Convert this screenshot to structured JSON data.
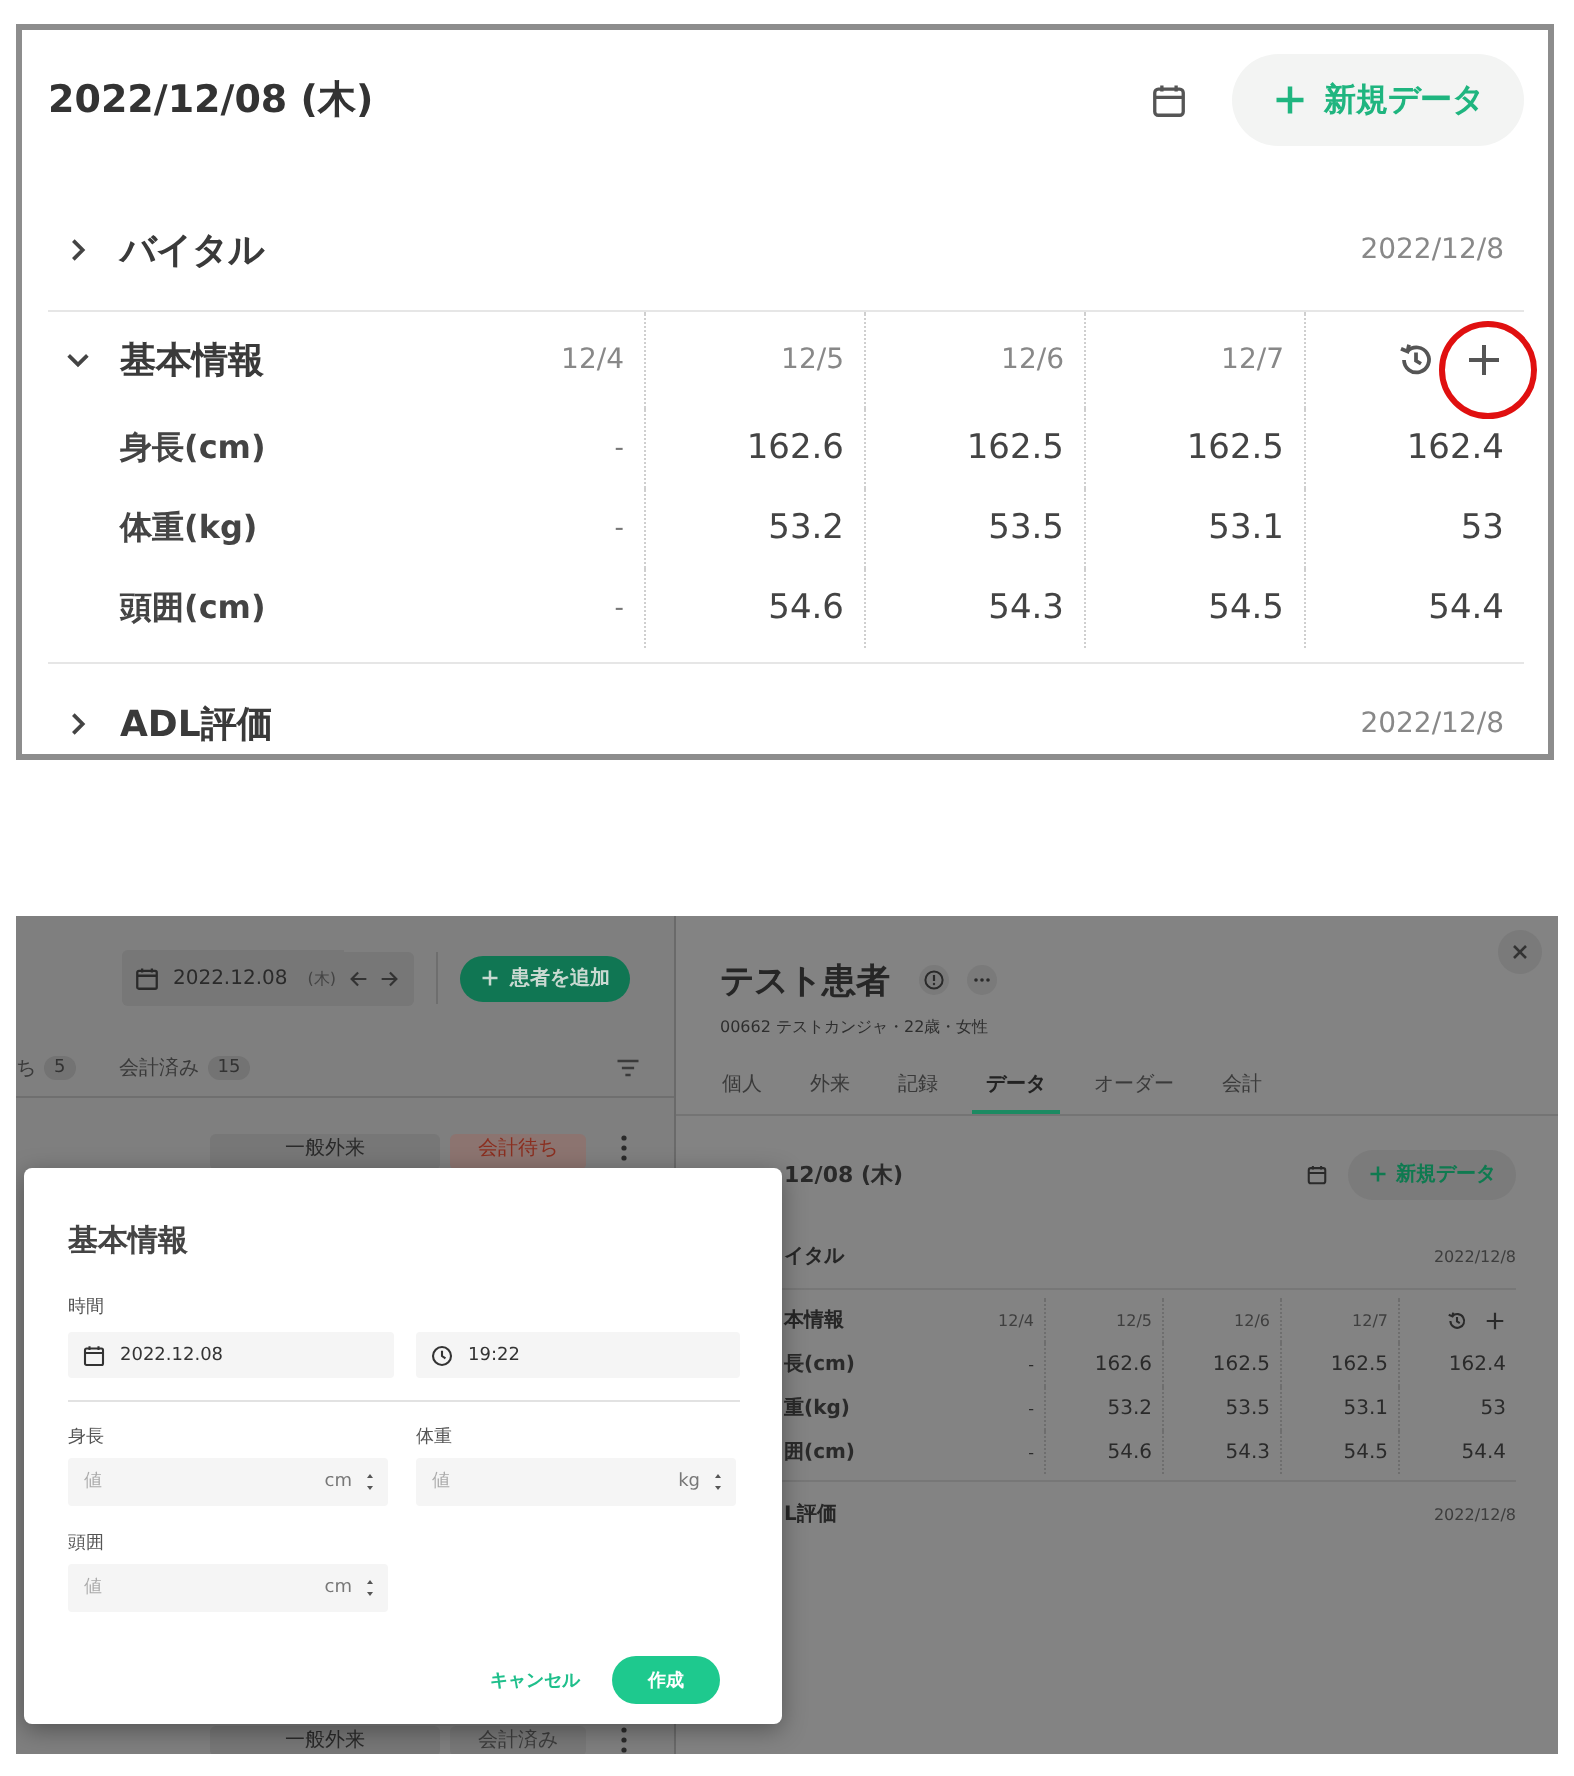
{
  "zoomed_panel": {
    "date": "2022/12/08 (木)",
    "new_button": "新規データ",
    "sections": [
      {
        "kind": "section",
        "title": "バイタル",
        "expanded": false,
        "date": "2022/12/8"
      },
      {
        "kind": "table",
        "title": "基本情報",
        "expanded": true,
        "columns": [
          "12/4",
          "12/5",
          "12/6",
          "12/7"
        ],
        "rows": [
          {
            "label": "身長(cm)",
            "values": [
              "-",
              "162.6",
              "162.5",
              "162.5",
              "162.4"
            ]
          },
          {
            "label": "体重(kg)",
            "values": [
              "-",
              "53.2",
              "53.5",
              "53.1",
              "53"
            ]
          },
          {
            "label": "頭囲(cm)",
            "values": [
              "-",
              "54.6",
              "54.3",
              "54.5",
              "54.4"
            ]
          }
        ]
      },
      {
        "kind": "section",
        "title": "ADL評価",
        "expanded": false,
        "date": "2022/12/8"
      }
    ]
  },
  "screen": {
    "left_pane": {
      "date": "2022.12.08",
      "weekday": "(木)",
      "add_button": "患者を追加",
      "tabs": [
        {
          "label": "ち",
          "count": "5"
        },
        {
          "label": "会計済み",
          "count": "15"
        }
      ],
      "rows": [
        {
          "tags": [
            {
              "label": "一般外来",
              "kind": "visit"
            },
            {
              "label": "会計待ち",
              "kind": "pending"
            }
          ]
        },
        {
          "tags": [
            {
              "label": "一般外来",
              "kind": "visit"
            },
            {
              "label": "会計済み",
              "kind": "done"
            }
          ]
        }
      ]
    },
    "right_pane": {
      "patient_name": "テスト患者",
      "patient_info": "00662 テストカンジャ・22歳・女性",
      "tabs": [
        {
          "label": "個人",
          "selected": false
        },
        {
          "label": "外来",
          "selected": false
        },
        {
          "label": "記録",
          "selected": false
        },
        {
          "label": "データ",
          "selected": true
        },
        {
          "label": "オーダー",
          "selected": false
        },
        {
          "label": "会計",
          "selected": false
        }
      ],
      "data": {
        "date": "12/08 (木)",
        "new_button": "新規データ",
        "sections": [
          {
            "kind": "section",
            "title": "イタル",
            "date": "2022/12/8"
          },
          {
            "kind": "table",
            "title": "本情報",
            "columns": [
              "12/4",
              "12/5",
              "12/6",
              "12/7"
            ],
            "rows": [
              {
                "label": "長(cm)",
                "values": [
                  "-",
                  "162.6",
                  "162.5",
                  "162.5",
                  "162.4"
                ]
              },
              {
                "label": "重(kg)",
                "values": [
                  "-",
                  "53.2",
                  "53.5",
                  "53.1",
                  "53"
                ]
              },
              {
                "label": "囲(cm)",
                "values": [
                  "-",
                  "54.6",
                  "54.3",
                  "54.5",
                  "54.4"
                ]
              }
            ]
          },
          {
            "kind": "section",
            "title": "L評価",
            "date": "2022/12/8"
          }
        ]
      }
    }
  },
  "modal": {
    "title": "基本情報",
    "time_label": "時間",
    "date_value": "2022.12.08",
    "time_value": "19:22",
    "fields": [
      {
        "label": "身長",
        "placeholder": "値",
        "unit": "cm"
      },
      {
        "label": "体重",
        "placeholder": "値",
        "unit": "kg"
      },
      {
        "label": "頭囲",
        "placeholder": "値",
        "unit": "cm"
      }
    ],
    "cancel": "キャンセル",
    "submit": "作成"
  }
}
